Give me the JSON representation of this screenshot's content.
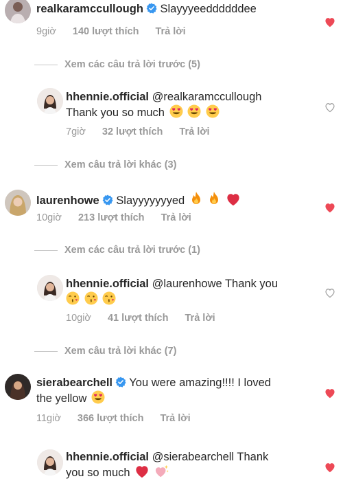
{
  "comments": [
    {
      "username": "realkaramccullough",
      "text": "Slayyyeeddddddee",
      "time": "9giờ",
      "likes": "140 lượt thích",
      "reply": "Trả lời",
      "liked": true,
      "emojis": []
    },
    {
      "username": "hhennie.official",
      "mention": "@realkaramccullough",
      "text": "Thank you so much",
      "time": "7giờ",
      "likes": "32 lượt thích",
      "reply": "Trả lời",
      "liked": false,
      "emojis": [
        "heart-eyes",
        "heart-eyes",
        "heart-eyes"
      ]
    },
    {
      "username": "laurenhowe",
      "text": "Slayyyyyyyed",
      "time": "10giờ",
      "likes": "213 lượt thích",
      "reply": "Trả lời",
      "liked": true,
      "emojis": [
        "fire",
        "fire",
        "red-heart"
      ]
    },
    {
      "username": "hhennie.official",
      "mention": "@laurenhowe",
      "text": "Thank you",
      "time": "10giờ",
      "likes": "41 lượt thích",
      "reply": "Trả lời",
      "liked": false,
      "emojis": [
        "kissing",
        "kissing",
        "kissing"
      ]
    },
    {
      "username": "sierabearchell",
      "text": "You were amazing!!!! I loved",
      "text2": "the yellow",
      "time": "11giờ",
      "likes": "366 lượt thích",
      "reply": "Trả lời",
      "liked": true,
      "emojis": [
        "heart-eyes"
      ]
    },
    {
      "username": "hhennie.official",
      "mention": "@sierabearchell",
      "text": "Thank",
      "text2": "you so much",
      "liked": true,
      "emojis": [
        "red-heart",
        "sparkling-heart"
      ]
    }
  ],
  "view_previous_1": "Xem các câu trả lời trước (5)",
  "view_more_1": "Xem câu trả lời khác (3)",
  "view_previous_2": "Xem các câu trả lời trước (1)",
  "view_more_2": "Xem câu trả lời khác (7)",
  "colors": {
    "liked_heart": "#ed4956",
    "verified": "#3897f0",
    "meta": "#999999"
  }
}
